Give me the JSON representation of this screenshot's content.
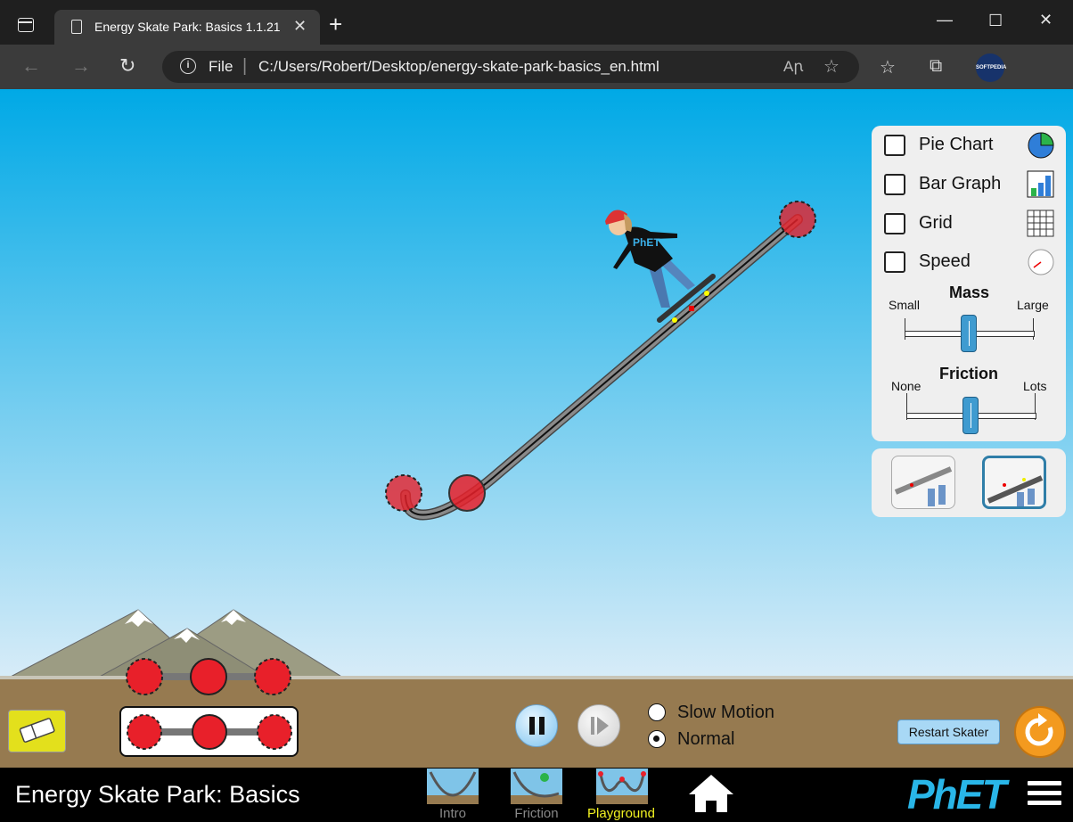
{
  "browser": {
    "tab_title": "Energy Skate Park: Basics 1.1.21",
    "address_scheme": "File",
    "url": "C:/Users/Robert/Desktop/energy-skate-park-basics_en.html",
    "profile_label": "SOFTPEDIA"
  },
  "controls_panel": {
    "checkboxes": [
      {
        "label": "Pie Chart",
        "checked": false,
        "icon": "pie-chart-icon"
      },
      {
        "label": "Bar Graph",
        "checked": false,
        "icon": "bar-graph-icon"
      },
      {
        "label": "Grid",
        "checked": false,
        "icon": "grid-icon"
      },
      {
        "label": "Speed",
        "checked": false,
        "icon": "speedometer-icon"
      }
    ],
    "mass": {
      "title": "Mass",
      "min_label": "Small",
      "max_label": "Large",
      "value": 0.5
    },
    "friction": {
      "title": "Friction",
      "min_label": "None",
      "max_label": "Lots",
      "value": 0.5
    }
  },
  "playback": {
    "speed_options": [
      {
        "label": "Slow Motion",
        "selected": false
      },
      {
        "label": "Normal",
        "selected": true
      }
    ],
    "restart_label": "Restart Skater"
  },
  "app": {
    "title": "Energy Skate Park: Basics",
    "screens": [
      {
        "label": "Intro",
        "selected": false
      },
      {
        "label": "Friction",
        "selected": false
      },
      {
        "label": "Playground",
        "selected": true
      }
    ],
    "brand": "PhET",
    "colors": {
      "sky_top": "#00a9e6",
      "sky_bottom": "#d8ecf8",
      "ground": "#967a50",
      "control_point": "#e8202a",
      "selected_screen": "#f2f221"
    }
  }
}
